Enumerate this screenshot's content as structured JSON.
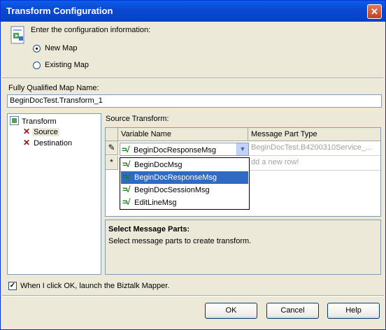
{
  "window": {
    "title": "Transform Configuration",
    "close_glyph": "✕"
  },
  "intro": {
    "label": "Enter the configuration information:"
  },
  "options": {
    "new_map": "New Map",
    "existing_map": "Existing Map",
    "selected": "new_map"
  },
  "map_name": {
    "label": "Fully Qualified Map Name:",
    "value": "BeginDocTest.Transform_1"
  },
  "tree": {
    "root": "Transform",
    "children": [
      "Source",
      "Destination"
    ],
    "selected": "Source"
  },
  "source_transform": {
    "label": "Source Transform:",
    "columns": [
      "Variable Name",
      "Message Part Type"
    ],
    "row": {
      "marker": "✎",
      "variable": "BeginDocResponseMsg",
      "type": "BeginDocTest.B4200310Service_..."
    },
    "new_row": {
      "marker": "*",
      "text": "dd a new row!"
    },
    "dropdown_options": [
      "BeginDocMsg",
      "BeginDocResponseMsg",
      "BeginDocSessionMsg",
      "EditLineMsg"
    ],
    "dropdown_selected": "BeginDocResponseMsg",
    "icon_glyph": "=√"
  },
  "description": {
    "title": "Select Message Parts:",
    "text": "Select message parts to create transform."
  },
  "launch_mapper": {
    "label": "When I click OK, launch the Biztalk Mapper.",
    "checked": true,
    "check_glyph": "✓"
  },
  "buttons": {
    "ok": "OK",
    "cancel": "Cancel",
    "help": "Help"
  },
  "colors": {
    "title_bar": "#0842c4",
    "selection": "#316ac5",
    "dialog_bg": "#ece9d8"
  }
}
